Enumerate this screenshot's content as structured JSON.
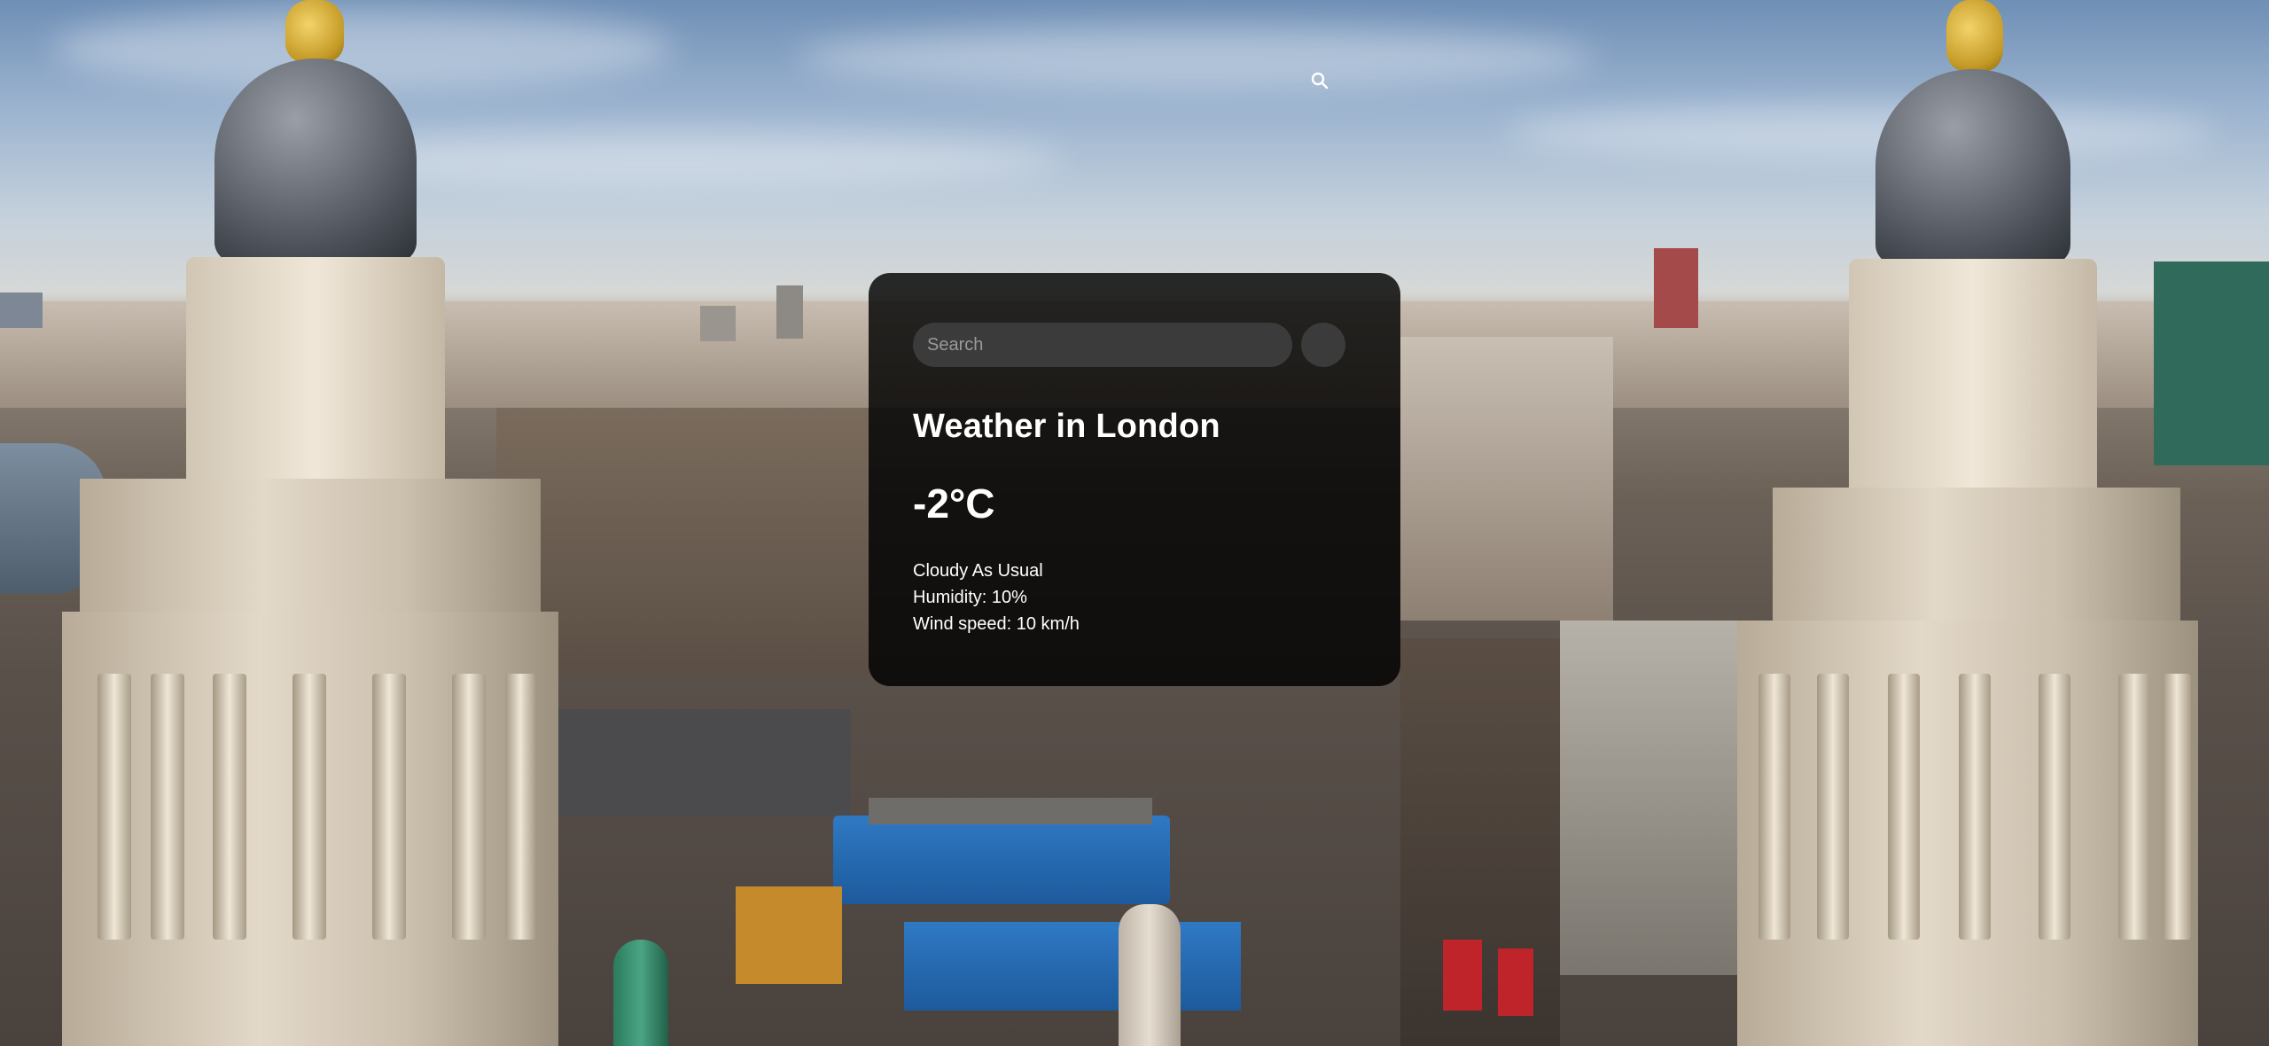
{
  "page": {
    "background_scene": "London skyline cityscape photo",
    "colors": {
      "card_background": "#000000d1",
      "card_text": "#ffffff",
      "input_background": "#3b3b3b",
      "placeholder_text": "#9a9a9a"
    }
  },
  "top_search_toggle": {
    "icon": "magnifying-glass-icon"
  },
  "weather_card": {
    "search": {
      "placeholder": "Search",
      "value": "",
      "button_icon": "search-button"
    },
    "title": "Weather in London",
    "temperature": "-2°C",
    "description": "Cloudy As Usual",
    "humidity": "Humidity: 10%",
    "wind": "Wind speed: 10 km/h"
  }
}
